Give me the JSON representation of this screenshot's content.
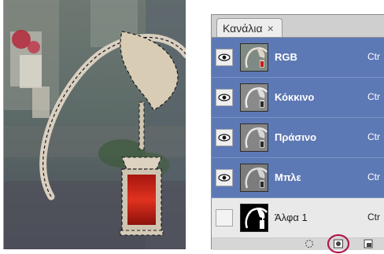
{
  "panel": {
    "tab_label": "Κανάλια",
    "tab_close": "×"
  },
  "channels": [
    {
      "name": "RGB",
      "shortcut": "Ctr",
      "visible": true,
      "selected": true,
      "thumb_accent": "#cc1a1a"
    },
    {
      "name": "Κόκκινο",
      "shortcut": "Ctr",
      "visible": true,
      "selected": true,
      "thumb_accent": "#2a2a2a"
    },
    {
      "name": "Πράσινο",
      "shortcut": "Ctr",
      "visible": true,
      "selected": true,
      "thumb_accent": "#2a2a2a"
    },
    {
      "name": "Μπλε",
      "shortcut": "Ctr",
      "visible": true,
      "selected": true,
      "thumb_accent": "#2a2a2a"
    },
    {
      "name": "Άλφα 1",
      "shortcut": "Ctr",
      "visible": false,
      "selected": false,
      "thumb_accent": "#ffffff"
    }
  ],
  "footer_icons": [
    "load-selection-icon",
    "save-selection-as-channel-icon",
    "new-channel-icon"
  ],
  "colors": {
    "selected_row": "#5d79b5",
    "highlight_circle": "#b0174f",
    "lantern_glass": "#d2241c"
  }
}
